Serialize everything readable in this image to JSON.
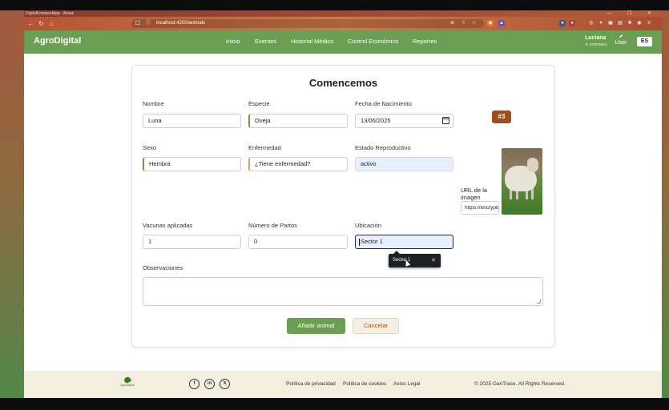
{
  "browser": {
    "window_title": "DigitalFrontendApp - Brave",
    "url": "localhost:4200/animals",
    "window_controls": "— ❐ ✕"
  },
  "navbar": {
    "brand": "AgroDigital",
    "menu": [
      "Inicio",
      "Eventos",
      "Historial Médico",
      "Control Económico",
      "Reportes"
    ],
    "user_name": "Luciana",
    "user_count": "6 animales",
    "user_link": "User",
    "language": "ES"
  },
  "form": {
    "title": "Comencemos",
    "badge": "#3",
    "fields": {
      "nombre": {
        "label": "Nombre",
        "value": "Luna"
      },
      "especie": {
        "label": "Especie",
        "value": "Oveja"
      },
      "fecha": {
        "label": "Fecha de Nacimiento",
        "value": "13/06/2025"
      },
      "sexo": {
        "label": "Sexo",
        "value": "Hembra"
      },
      "enfermedad": {
        "label": "Enfermedad",
        "value": "¿Tiene enfermedad?"
      },
      "estado": {
        "label": "Estado Reproductivo",
        "value": "activo"
      },
      "vacunas": {
        "label": "Vacunas aplicadas",
        "value": "1"
      },
      "partos": {
        "label": "Número de Partos",
        "value": "0"
      },
      "ubicacion": {
        "label": "Ubicación",
        "value": "Sector 1"
      },
      "url": {
        "label": "URL de la imagen",
        "value": "https://encrypte"
      },
      "observaciones": {
        "label": "Observaciones",
        "value": ""
      }
    },
    "autocomplete": {
      "suggestion": "Sector 1",
      "close": "✕"
    },
    "submit_label": "Añadir animal",
    "cancel_label": "Cancelar"
  },
  "footer": {
    "logo_text": "AgroDigital",
    "social": [
      "f",
      "in",
      "𝕏"
    ],
    "links": [
      "Política de privacidad",
      "Política de cookies",
      "Aviso Legal"
    ],
    "copyright": "© 2025 GanTrace. All Rights Reserved."
  },
  "colors": {
    "primary_green": "#6a9e52",
    "badge_brown": "#9c4e1e",
    "footer_bg": "#f3efe0"
  }
}
